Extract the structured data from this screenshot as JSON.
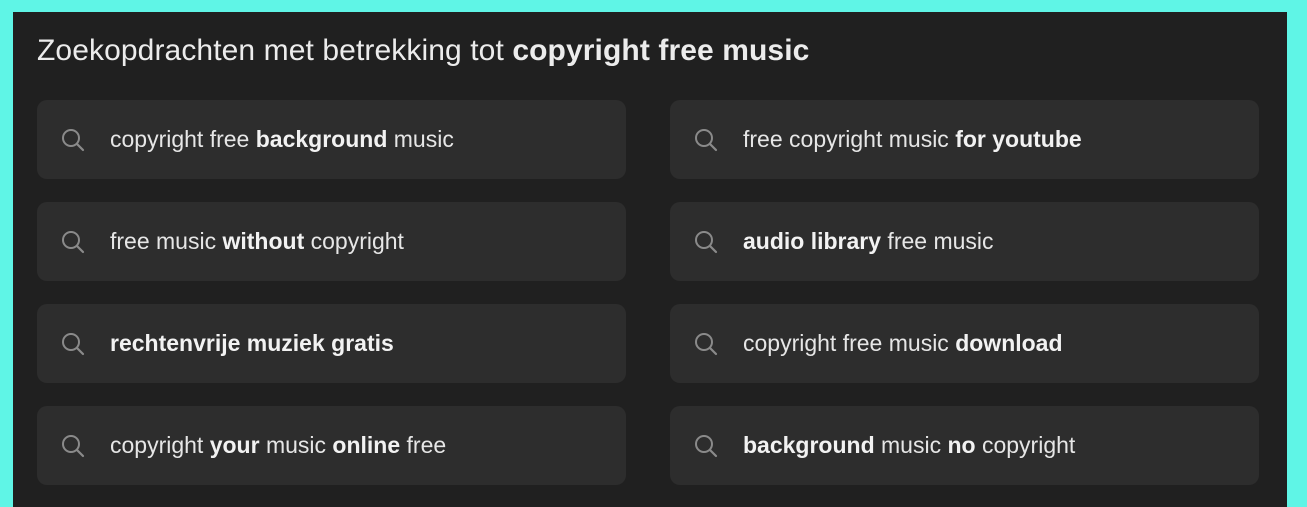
{
  "related_searches": {
    "heading_prefix": "Zoekopdrachten met betrekking tot ",
    "heading_query": "copyright free music",
    "items": [
      {
        "parts": [
          {
            "text": "copyright free ",
            "bold": false
          },
          {
            "text": "background",
            "bold": true
          },
          {
            "text": " music",
            "bold": false
          }
        ]
      },
      {
        "parts": [
          {
            "text": "free copyright music ",
            "bold": false
          },
          {
            "text": "for youtube",
            "bold": true
          }
        ]
      },
      {
        "parts": [
          {
            "text": "free music ",
            "bold": false
          },
          {
            "text": "without",
            "bold": true
          },
          {
            "text": " copyright",
            "bold": false
          }
        ]
      },
      {
        "parts": [
          {
            "text": "audio library",
            "bold": true
          },
          {
            "text": " free music",
            "bold": false
          }
        ]
      },
      {
        "parts": [
          {
            "text": "rechtenvrije muziek gratis",
            "bold": true
          }
        ]
      },
      {
        "parts": [
          {
            "text": "copyright free music ",
            "bold": false
          },
          {
            "text": "download",
            "bold": true
          }
        ]
      },
      {
        "parts": [
          {
            "text": "copyright ",
            "bold": false
          },
          {
            "text": "your",
            "bold": true
          },
          {
            "text": " music ",
            "bold": false
          },
          {
            "text": "online",
            "bold": true
          },
          {
            "text": " free",
            "bold": false
          }
        ]
      },
      {
        "parts": [
          {
            "text": "background",
            "bold": true
          },
          {
            "text": " music ",
            "bold": false
          },
          {
            "text": "no",
            "bold": true
          },
          {
            "text": " copyright",
            "bold": false
          }
        ]
      }
    ],
    "icon": "search-icon"
  },
  "colors": {
    "page_background": "#5ff5e6",
    "panel_background": "#202020",
    "chip_background": "#2d2d2d",
    "text": "#e6e6e6",
    "icon": "#8a8a8a"
  }
}
